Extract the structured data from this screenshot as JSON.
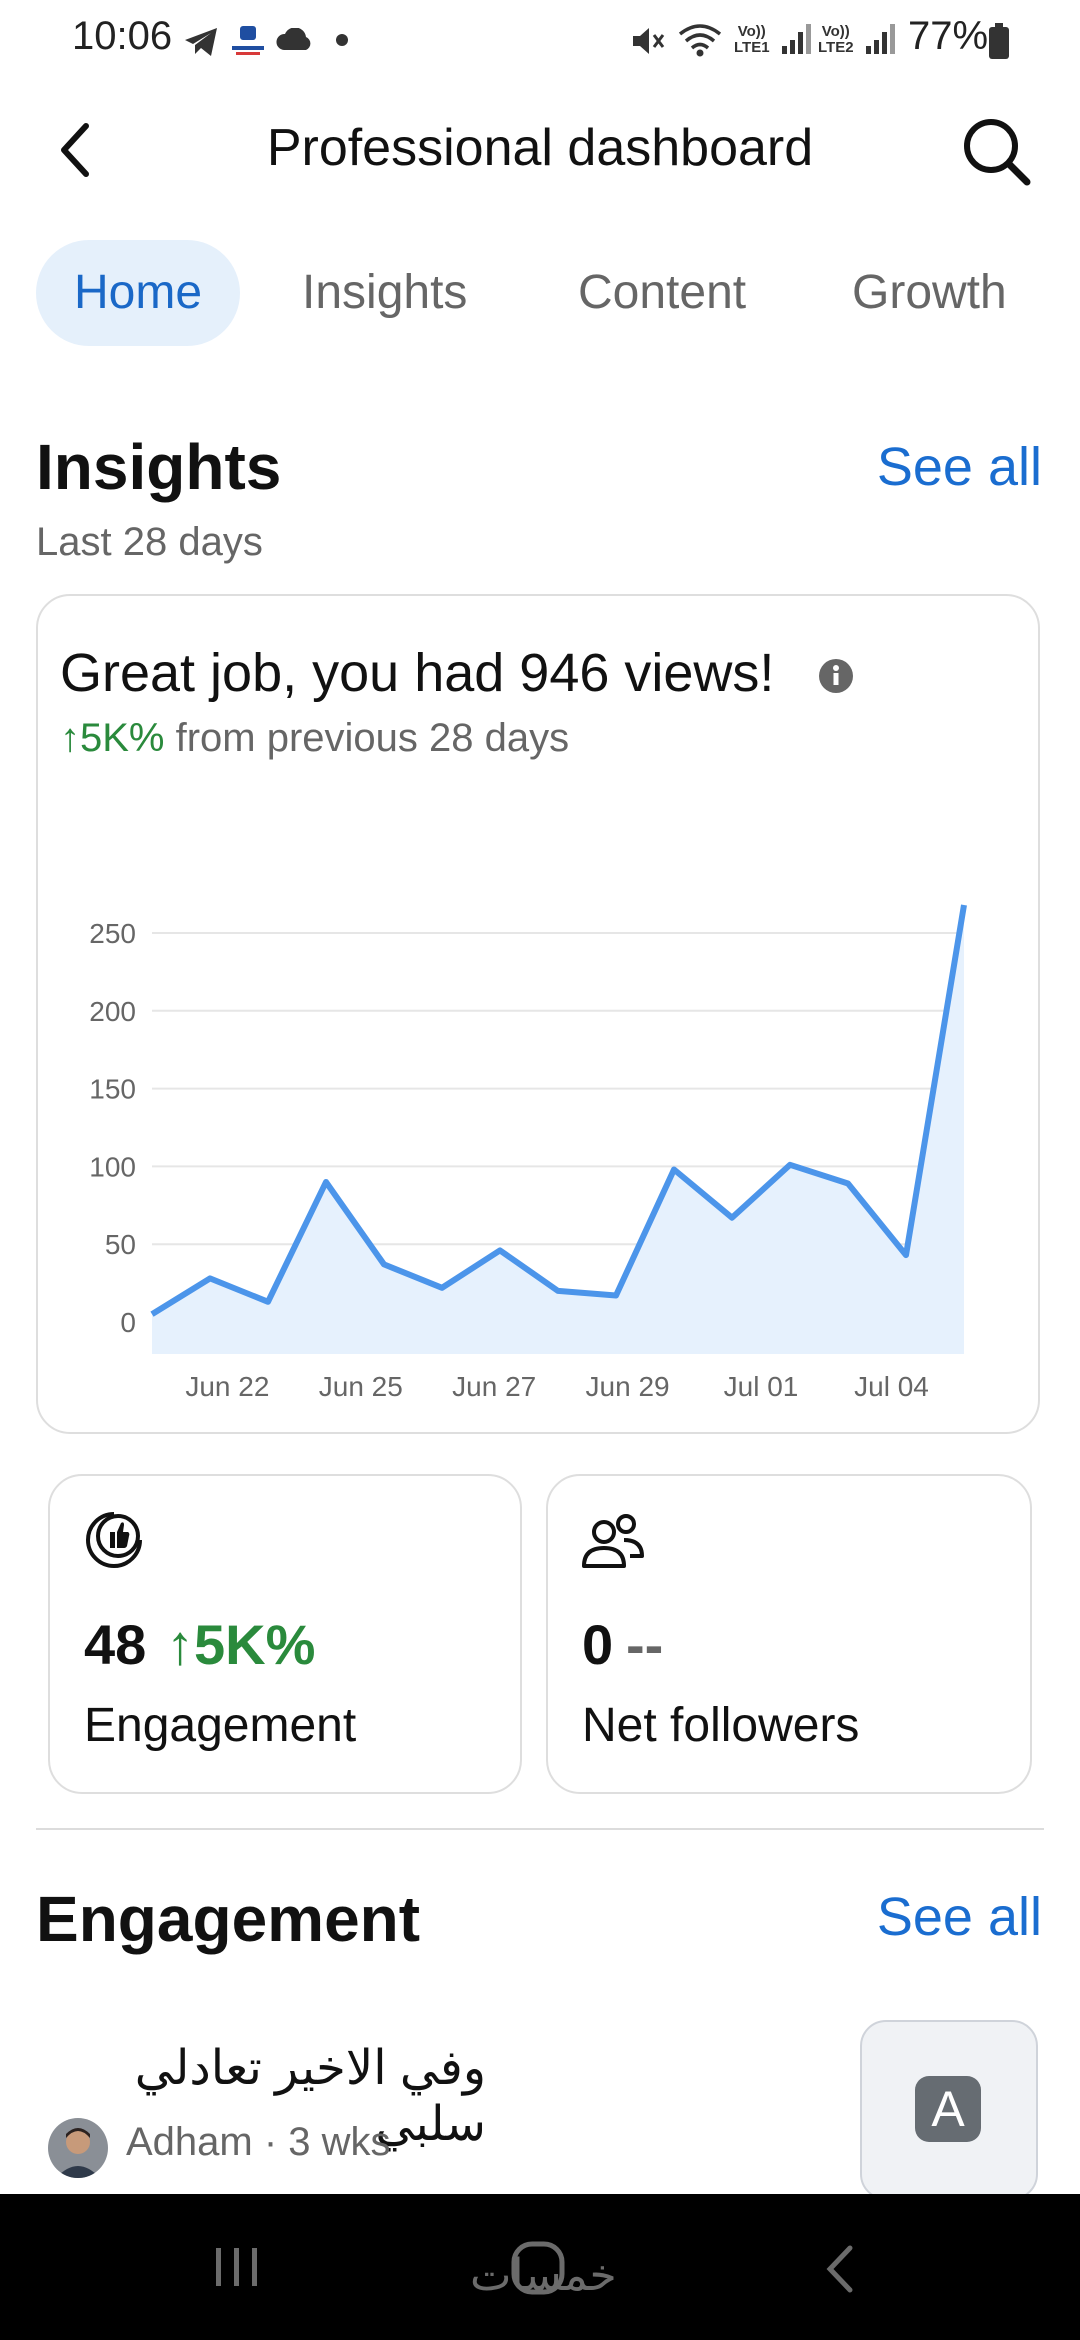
{
  "status_bar": {
    "time": "10:06",
    "battery": "77%",
    "lte1": "LTE1",
    "lte2": "LTE2",
    "vo1": "Vo))",
    "vo2": "Vo))"
  },
  "header": {
    "title": "Professional dashboard"
  },
  "tabs": [
    {
      "label": "Home",
      "active": true
    },
    {
      "label": "Insights",
      "active": false
    },
    {
      "label": "Content",
      "active": false
    },
    {
      "label": "Growth",
      "active": false
    }
  ],
  "insights": {
    "title": "Insights",
    "see_all": "See all",
    "period": "Last 28 days",
    "headline": "Great job, you had 946 views!",
    "change_value": "↑5K%",
    "change_text": " from previous 28 days"
  },
  "chart_data": {
    "type": "area",
    "x_ticks": [
      "Jun 22",
      "Jun 25",
      "Jun 27",
      "Jun 29",
      "Jul 01",
      "Jul 04"
    ],
    "y_ticks": [
      0,
      50,
      100,
      150,
      200,
      250
    ],
    "ylim": [
      0,
      270
    ],
    "values": [
      5,
      28,
      13,
      90,
      37,
      22,
      46,
      20,
      17,
      98,
      67,
      101,
      89,
      43,
      268
    ],
    "color": "#4c95ea",
    "fill": "#e6f1fd"
  },
  "metrics": [
    {
      "value": "48",
      "change": "↑5K%",
      "change_color": "#2a8a3c",
      "label": "Engagement",
      "icon": "like-icon"
    },
    {
      "value": "0",
      "change": "--",
      "change_color": "#666666",
      "label": "Net followers",
      "icon": "people-icon"
    }
  ],
  "engagement": {
    "title": "Engagement",
    "see_all": "See all",
    "post": {
      "text": "وفي الاخير تعادلي سلبي",
      "author": "Adham · 3 wks",
      "thumb_letter": "A"
    }
  },
  "nav": {
    "watermark": "خمسات"
  }
}
